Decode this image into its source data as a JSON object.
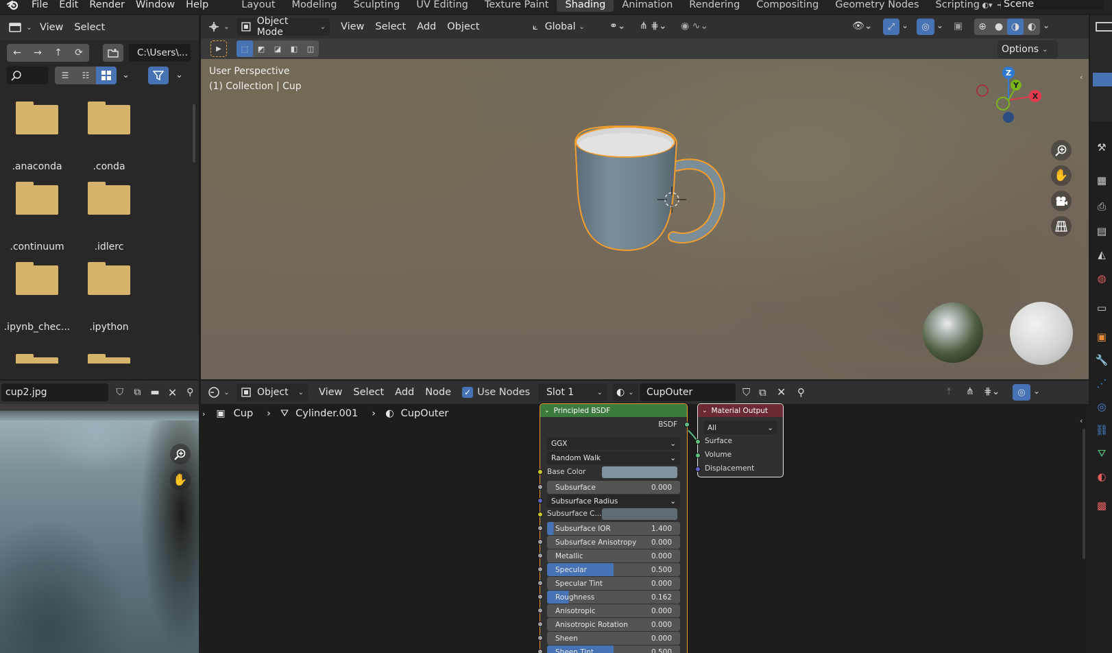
{
  "topbar": {
    "menus": [
      "File",
      "Edit",
      "Render",
      "Window",
      "Help"
    ],
    "workspaces": [
      "Layout",
      "Modeling",
      "Sculpting",
      "UV Editing",
      "Texture Paint",
      "Shading",
      "Animation",
      "Rendering",
      "Compositing",
      "Geometry Nodes",
      "Scripting"
    ],
    "active_workspace": "Shading",
    "add_tab": "+",
    "scene": "Scene"
  },
  "file_browser": {
    "menu_view": "View",
    "menu_select": "Select",
    "path": "C:\\Users\\...",
    "items": [
      ".anaconda",
      ".conda",
      ".continuum",
      ".idlerc",
      ".ipynb_chec...",
      ".ipython"
    ]
  },
  "viewport": {
    "mode": "Object Mode",
    "menus": [
      "View",
      "Select",
      "Add",
      "Object"
    ],
    "transform": "Global",
    "options": "Options",
    "perspective": "User Perspective",
    "collection": "(1) Collection | Cup",
    "gizmo": {
      "z": "Z",
      "y": "Y",
      "x": "X"
    }
  },
  "image_editor": {
    "image_name": "cup2.jpg"
  },
  "node_editor": {
    "object_type": "Object",
    "menus": [
      "View",
      "Select",
      "Add",
      "Node"
    ],
    "use_nodes": "Use Nodes",
    "slot": "Slot 1",
    "material": "CupOuter",
    "breadcrumb": {
      "object": "Cup",
      "mesh": "Cylinder.001",
      "material": "CupOuter"
    },
    "bsdf": {
      "title": "Principled BSDF",
      "output": "BSDF",
      "distribution": "GGX",
      "subsurface_method": "Random Walk",
      "base_color_label": "Base Color",
      "base_color": "#7f939c",
      "subsurface_color_label": "Subsurface C...",
      "subsurface_radius": "Subsurface Radius",
      "fields": [
        {
          "label": "Subsurface",
          "value": "0.000",
          "fill": 0.0
        },
        {
          "label": "Subsurface IOR",
          "value": "1.400",
          "fill": 0.05
        },
        {
          "label": "Subsurface Anisotropy",
          "value": "0.000",
          "fill": 0.0
        },
        {
          "label": "Metallic",
          "value": "0.000",
          "fill": 0.0
        },
        {
          "label": "Specular",
          "value": "0.500",
          "fill": 0.5
        },
        {
          "label": "Specular Tint",
          "value": "0.000",
          "fill": 0.0
        },
        {
          "label": "Roughness",
          "value": "0.162",
          "fill": 0.162
        },
        {
          "label": "Anisotropic",
          "value": "0.000",
          "fill": 0.0
        },
        {
          "label": "Anisotropic Rotation",
          "value": "0.000",
          "fill": 0.0
        },
        {
          "label": "Sheen",
          "value": "0.000",
          "fill": 0.0
        },
        {
          "label": "Sheen Tint",
          "value": "0.500",
          "fill": 0.5
        }
      ]
    },
    "output_node": {
      "title": "Material Output",
      "target": "All",
      "inputs": [
        "Surface",
        "Volume",
        "Displacement"
      ]
    }
  },
  "colors": {
    "accent_blue": "#4772b3",
    "selection_orange": "#f39e2c",
    "bsdf_header": "#3d7a3d",
    "output_header": "#6b2a34",
    "folder": "#d6b46c"
  }
}
